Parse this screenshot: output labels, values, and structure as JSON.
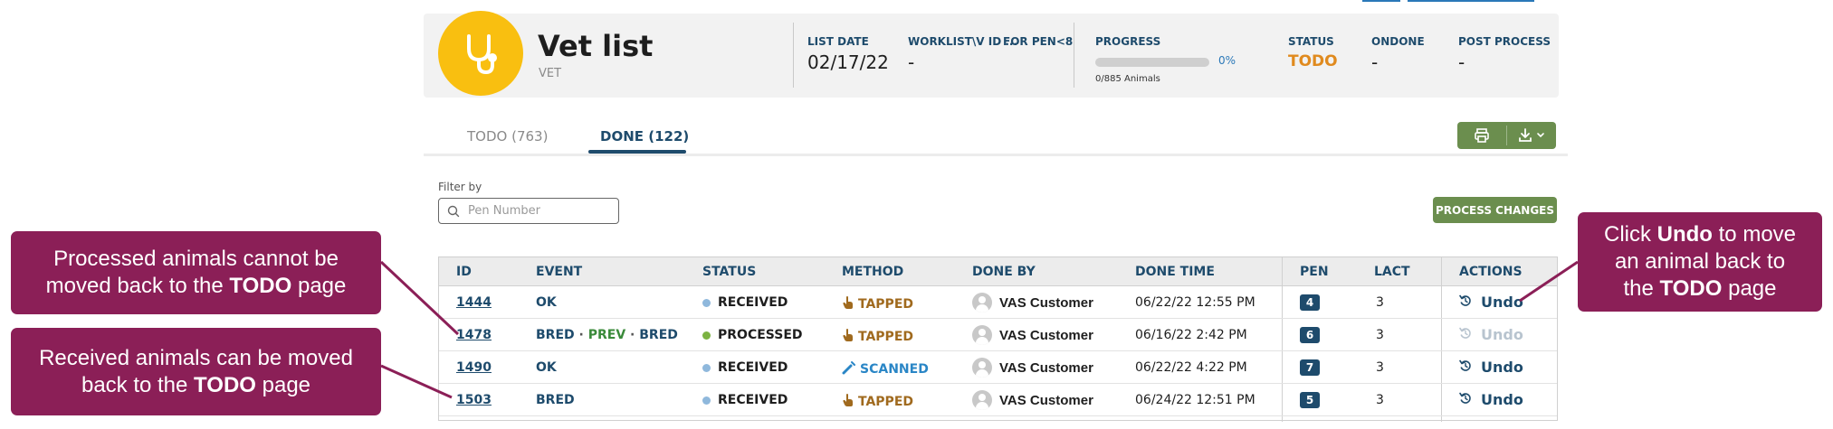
{
  "header": {
    "title": "Vet list",
    "subtitle": "VET",
    "list_date_label": "LIST DATE",
    "list_date_value": "02/17/22",
    "worklist_label": "WORKLIST\\V ID ...",
    "worklist_value": "-",
    "for_pen_label": "FOR PEN<8",
    "progress_label": "PROGRESS",
    "progress_percent_text": "0%",
    "progress_fraction": 0,
    "progress_caption": "0/885 Animals",
    "status_label": "STATUS",
    "status_value": "TODO",
    "ondone_label": "ONDONE",
    "ondone_value": "-",
    "post_process_label": "POST PROCESS",
    "post_process_value": "-"
  },
  "tabs": [
    {
      "label": "TODO (763)",
      "active": false
    },
    {
      "label": "DONE (122)",
      "active": true
    }
  ],
  "filter": {
    "label": "Filter by",
    "placeholder": "Pen Number"
  },
  "process_button": "PROCESS CHANGES",
  "table": {
    "columns": [
      "ID",
      "EVENT",
      "STATUS",
      "METHOD",
      "DONE BY",
      "DONE TIME",
      "PEN",
      "LACT",
      "ACTIONS"
    ],
    "rows": [
      {
        "id": "1444",
        "event_parts": [
          {
            "text": "OK",
            "color": "#1e4b6c"
          }
        ],
        "status": "RECEIVED",
        "status_color": "#8fb8dc",
        "method": "TAPPED",
        "method_color": "#a06a1e",
        "done_by": "VAS Customer",
        "done_time": "06/22/22 12:55 PM",
        "pen": "4",
        "lact": "3",
        "action": "Undo",
        "action_enabled": true
      },
      {
        "id": "1478",
        "event_parts": [
          {
            "text": "BRED",
            "color": "#1e4b6c"
          },
          {
            "text": " · ",
            "color": "#555555"
          },
          {
            "text": "PREV",
            "color": "#3a8a3a"
          },
          {
            "text": " · ",
            "color": "#555555"
          },
          {
            "text": "BRED",
            "color": "#1e4b6c"
          }
        ],
        "status": "PROCESSED",
        "status_color": "#7cb342",
        "method": "TAPPED",
        "method_color": "#a06a1e",
        "done_by": "VAS Customer",
        "done_time": "06/16/22 2:42 PM",
        "pen": "6",
        "lact": "3",
        "action": "Undo",
        "action_enabled": false
      },
      {
        "id": "1490",
        "event_parts": [
          {
            "text": "OK",
            "color": "#1e4b6c"
          }
        ],
        "status": "RECEIVED",
        "status_color": "#8fb8dc",
        "method": "SCANNED",
        "method_color": "#2a86c6",
        "done_by": "VAS Customer",
        "done_time": "06/22/22 4:22 PM",
        "pen": "7",
        "lact": "3",
        "action": "Undo",
        "action_enabled": true
      },
      {
        "id": "1503",
        "event_parts": [
          {
            "text": "BRED",
            "color": "#1e4b6c"
          }
        ],
        "status": "RECEIVED",
        "status_color": "#8fb8dc",
        "method": "TAPPED",
        "method_color": "#a06a1e",
        "done_by": "VAS Customer",
        "done_time": "06/24/22 12:51 PM",
        "pen": "5",
        "lact": "3",
        "action": "Undo",
        "action_enabled": true
      }
    ]
  },
  "callouts": {
    "processed": {
      "line1": "Processed animals cannot be",
      "line2_pre": "moved back to the ",
      "line2_bold": "TODO",
      "line2_post": " page"
    },
    "received": {
      "line1": "Received animals can be moved",
      "line2_pre": "back to the ",
      "line2_bold": "TODO",
      "line2_post": " page"
    },
    "undo": {
      "l1_pre": "Click ",
      "l1_bold": "Undo",
      "l1_post": " to move",
      "line2": "an animal back to",
      "l3_pre": "the ",
      "l3_bold": "TODO",
      "l3_post": " page"
    }
  },
  "colors": {
    "brand_yellow": "#f9bf10",
    "primary_blue": "#1e4b6c",
    "button_green": "#6b8e4e",
    "callout_maroon": "#8b1f57",
    "status_todo": "#e08a1e"
  },
  "icons": {
    "logo": "stethoscope-icon",
    "print": "printer-icon",
    "download": "download-icon",
    "search": "search-icon",
    "undo": "undo-icon",
    "tapped": "hand-tap-icon",
    "scanned": "scanner-wand-icon"
  }
}
